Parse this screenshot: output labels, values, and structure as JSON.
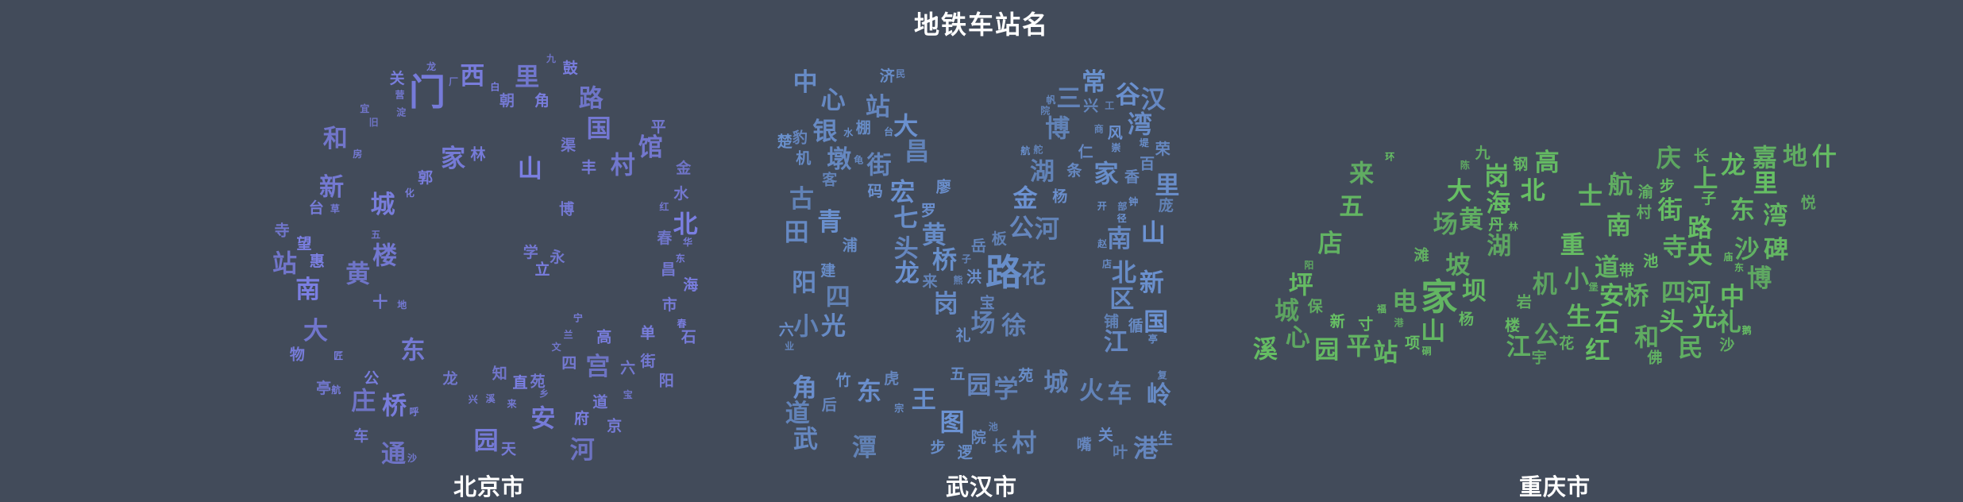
{
  "title": "地铁车站名",
  "chart_data": [
    {
      "type": "wordcloud",
      "city": "北京市",
      "color": "#7b7fe3",
      "words": [
        [
          "门",
          4
        ],
        [
          "路",
          3
        ],
        [
          "村",
          3
        ],
        [
          "宫",
          3
        ],
        [
          "里",
          3
        ],
        [
          "庄",
          3
        ],
        [
          "桥",
          3
        ],
        [
          "家",
          3
        ],
        [
          "西",
          3
        ],
        [
          "山",
          3
        ],
        [
          "站",
          3
        ],
        [
          "东",
          3
        ],
        [
          "黄",
          3
        ],
        [
          "河",
          3
        ],
        [
          "城",
          3
        ],
        [
          "园",
          3
        ],
        [
          "大",
          3
        ],
        [
          "安",
          3
        ],
        [
          "国",
          3
        ],
        [
          "南",
          3
        ],
        [
          "北",
          3
        ],
        [
          "新",
          3
        ],
        [
          "楼",
          3
        ],
        [
          "馆",
          3
        ],
        [
          "通",
          3
        ],
        [
          "和",
          3
        ],
        [
          "京",
          2
        ],
        [
          "惠",
          2
        ],
        [
          "府",
          2
        ],
        [
          "博",
          2
        ],
        [
          "立",
          2
        ],
        [
          "望",
          2
        ],
        [
          "海",
          2
        ],
        [
          "街",
          2
        ],
        [
          "鼓",
          2
        ],
        [
          "台",
          2
        ],
        [
          "郭",
          2
        ],
        [
          "高",
          2
        ],
        [
          "单",
          2
        ],
        [
          "渠",
          2
        ],
        [
          "关",
          2
        ],
        [
          "车",
          2
        ],
        [
          "丰",
          2
        ],
        [
          "苑",
          2
        ],
        [
          "天",
          2
        ],
        [
          "六",
          2
        ],
        [
          "学",
          2
        ],
        [
          "十",
          2
        ],
        [
          "平",
          2
        ],
        [
          "永",
          2
        ],
        [
          "朝",
          2
        ],
        [
          "四",
          2
        ],
        [
          "阳",
          2
        ],
        [
          "寺",
          2
        ],
        [
          "市",
          2
        ],
        [
          "金",
          2
        ],
        [
          "春",
          2
        ],
        [
          "林",
          2
        ],
        [
          "直",
          2
        ],
        [
          "公",
          2
        ],
        [
          "知",
          2
        ],
        [
          "龙",
          2
        ],
        [
          "角",
          2
        ],
        [
          "石",
          2
        ],
        [
          "亭",
          2
        ],
        [
          "昌",
          2
        ],
        [
          "道",
          2
        ],
        [
          "水",
          2
        ],
        [
          "物",
          2
        ],
        [
          "乡",
          1
        ],
        [
          "化",
          1
        ],
        [
          "九",
          1
        ],
        [
          "溪",
          1
        ],
        [
          "华",
          1
        ],
        [
          "红",
          1
        ],
        [
          "房",
          1
        ],
        [
          "宝",
          1
        ],
        [
          "兴",
          1
        ],
        [
          "五",
          1
        ],
        [
          "白",
          1
        ],
        [
          "匠",
          1
        ],
        [
          "营",
          1
        ],
        [
          "来",
          1
        ],
        [
          "宁",
          1
        ],
        [
          "宜",
          1
        ],
        [
          "龙",
          1
        ],
        [
          "兰",
          1
        ],
        [
          "草",
          1
        ],
        [
          "沙",
          1
        ],
        [
          "文",
          1
        ],
        [
          "地",
          1
        ],
        [
          "旧",
          1
        ],
        [
          "淀",
          1
        ],
        [
          "航",
          1
        ],
        [
          "呼",
          1
        ],
        [
          "春",
          1
        ],
        [
          "厂",
          1
        ],
        [
          "东",
          1
        ]
      ]
    },
    {
      "type": "wordcloud",
      "city": "武汉市",
      "color": "#6c93d3",
      "words": [
        [
          "路",
          4
        ],
        [
          "家",
          3
        ],
        [
          "街",
          3
        ],
        [
          "湖",
          3
        ],
        [
          "桥",
          3
        ],
        [
          "站",
          3
        ],
        [
          "区",
          3
        ],
        [
          "大",
          3
        ],
        [
          "阳",
          3
        ],
        [
          "村",
          3
        ],
        [
          "光",
          3
        ],
        [
          "汉",
          3
        ],
        [
          "古",
          3
        ],
        [
          "博",
          3
        ],
        [
          "山",
          3
        ],
        [
          "中",
          3
        ],
        [
          "岗",
          3
        ],
        [
          "国",
          3
        ],
        [
          "武",
          3
        ],
        [
          "宏",
          3
        ],
        [
          "银",
          3
        ],
        [
          "新",
          3
        ],
        [
          "场",
          3
        ],
        [
          "湾",
          3
        ],
        [
          "墩",
          3
        ],
        [
          "南",
          3
        ],
        [
          "角",
          3
        ],
        [
          "岭",
          3
        ],
        [
          "田",
          3
        ],
        [
          "头",
          3
        ],
        [
          "小",
          3
        ],
        [
          "王",
          3
        ],
        [
          "心",
          3
        ],
        [
          "青",
          3
        ],
        [
          "三",
          3
        ],
        [
          "河",
          3
        ],
        [
          "港",
          3
        ],
        [
          "城",
          3
        ],
        [
          "火",
          3
        ],
        [
          "常",
          3
        ],
        [
          "徐",
          3
        ],
        [
          "东",
          3
        ],
        [
          "花",
          3
        ],
        [
          "谷",
          3
        ],
        [
          "公",
          3
        ],
        [
          "龙",
          3
        ],
        [
          "江",
          3
        ],
        [
          "道",
          3
        ],
        [
          "里",
          3
        ],
        [
          "昌",
          3
        ],
        [
          "学",
          3
        ],
        [
          "园",
          3
        ],
        [
          "图",
          3
        ],
        [
          "四",
          3
        ],
        [
          "七",
          3
        ],
        [
          "黄",
          3
        ],
        [
          "北",
          3
        ],
        [
          "潭",
          3
        ],
        [
          "金",
          3
        ],
        [
          "车",
          3
        ],
        [
          "香",
          2
        ],
        [
          "关",
          2
        ],
        [
          "苑",
          2
        ],
        [
          "济",
          2
        ],
        [
          "风",
          2
        ],
        [
          "铺",
          2
        ],
        [
          "浦",
          2
        ],
        [
          "百",
          2
        ],
        [
          "竹",
          2
        ],
        [
          "杨",
          2
        ],
        [
          "兴",
          2
        ],
        [
          "楚",
          2
        ],
        [
          "院",
          2
        ],
        [
          "板",
          2
        ],
        [
          "荣",
          2
        ],
        [
          "嘴",
          2
        ],
        [
          "循",
          2
        ],
        [
          "礼",
          2
        ],
        [
          "豹",
          2
        ],
        [
          "客",
          2
        ],
        [
          "罗",
          2
        ],
        [
          "棚",
          2
        ],
        [
          "庞",
          2
        ],
        [
          "建",
          2
        ],
        [
          "宝",
          2
        ],
        [
          "条",
          2
        ],
        [
          "后",
          2
        ],
        [
          "五",
          2
        ],
        [
          "码",
          2
        ],
        [
          "机",
          2
        ],
        [
          "生",
          2
        ],
        [
          "洪",
          2
        ],
        [
          "来",
          2
        ],
        [
          "六",
          2
        ],
        [
          "廖",
          2
        ],
        [
          "逻",
          2
        ],
        [
          "长",
          2
        ],
        [
          "步",
          2
        ],
        [
          "虎",
          2
        ],
        [
          "岳",
          2
        ],
        [
          "仁",
          2
        ],
        [
          "叶",
          2
        ],
        [
          "工",
          1
        ],
        [
          "子",
          1
        ],
        [
          "台",
          1
        ],
        [
          "部",
          1
        ],
        [
          "复",
          1
        ],
        [
          "钟",
          1
        ],
        [
          "民",
          1
        ],
        [
          "宗",
          1
        ],
        [
          "业",
          1
        ],
        [
          "帆",
          1
        ],
        [
          "院",
          1
        ],
        [
          "赵",
          1
        ],
        [
          "水",
          1
        ],
        [
          "池",
          1
        ],
        [
          "开",
          1
        ],
        [
          "亭",
          1
        ],
        [
          "龟",
          1
        ],
        [
          "熊",
          1
        ],
        [
          "航",
          1
        ],
        [
          "崇",
          1
        ],
        [
          "径",
          1
        ],
        [
          "商",
          1
        ],
        [
          "堤",
          1
        ],
        [
          "店",
          1
        ],
        [
          "舵",
          1
        ]
      ]
    },
    {
      "type": "wordcloud",
      "city": "重庆市",
      "color": "#67c264",
      "words": [
        [
          "家",
          4
        ],
        [
          "路",
          3
        ],
        [
          "湖",
          3
        ],
        [
          "大",
          3
        ],
        [
          "城",
          3
        ],
        [
          "中",
          3
        ],
        [
          "岗",
          3
        ],
        [
          "湾",
          3
        ],
        [
          "场",
          3
        ],
        [
          "航",
          3
        ],
        [
          "民",
          3
        ],
        [
          "里",
          3
        ],
        [
          "山",
          3
        ],
        [
          "道",
          3
        ],
        [
          "地",
          3
        ],
        [
          "红",
          3
        ],
        [
          "北",
          3
        ],
        [
          "庆",
          3
        ],
        [
          "溪",
          3
        ],
        [
          "重",
          3
        ],
        [
          "坪",
          3
        ],
        [
          "园",
          3
        ],
        [
          "站",
          3
        ],
        [
          "坝",
          3
        ],
        [
          "四",
          3
        ],
        [
          "桥",
          3
        ],
        [
          "东",
          3
        ],
        [
          "沙",
          3
        ],
        [
          "上",
          3
        ],
        [
          "心",
          3
        ],
        [
          "嘉",
          3
        ],
        [
          "石",
          3
        ],
        [
          "小",
          3
        ],
        [
          "头",
          3
        ],
        [
          "江",
          3
        ],
        [
          "坡",
          3
        ],
        [
          "和",
          3
        ],
        [
          "机",
          3
        ],
        [
          "海",
          3
        ],
        [
          "礼",
          3
        ],
        [
          "南",
          3
        ],
        [
          "平",
          3
        ],
        [
          "寺",
          3
        ],
        [
          "什",
          3
        ],
        [
          "街",
          3
        ],
        [
          "光",
          3
        ],
        [
          "博",
          3
        ],
        [
          "碑",
          3
        ],
        [
          "央",
          3
        ],
        [
          "公",
          3
        ],
        [
          "店",
          3
        ],
        [
          "龙",
          3
        ],
        [
          "安",
          3
        ],
        [
          "生",
          3
        ],
        [
          "来",
          3
        ],
        [
          "河",
          3
        ],
        [
          "士",
          3
        ],
        [
          "黄",
          3
        ],
        [
          "电",
          3
        ],
        [
          "高",
          3
        ],
        [
          "五",
          3
        ],
        [
          "长",
          2
        ],
        [
          "宇",
          2
        ],
        [
          "渝",
          2
        ],
        [
          "项",
          2
        ],
        [
          "花",
          2
        ],
        [
          "新",
          2
        ],
        [
          "岩",
          2
        ],
        [
          "九",
          2
        ],
        [
          "沙",
          2
        ],
        [
          "杨",
          2
        ],
        [
          "悦",
          2
        ],
        [
          "池",
          2
        ],
        [
          "保",
          2
        ],
        [
          "楼",
          2
        ],
        [
          "步",
          2
        ],
        [
          "带",
          2
        ],
        [
          "村",
          2
        ],
        [
          "丹",
          2
        ],
        [
          "寸",
          2
        ],
        [
          "子",
          2
        ],
        [
          "滩",
          2
        ],
        [
          "佛",
          2
        ],
        [
          "钢",
          2
        ],
        [
          "东",
          1
        ],
        [
          "鹅",
          1
        ],
        [
          "福",
          1
        ],
        [
          "林",
          1
        ],
        [
          "陈",
          1
        ],
        [
          "环",
          1
        ],
        [
          "港",
          1
        ],
        [
          "庙",
          1
        ],
        [
          "硐",
          1
        ],
        [
          "堡",
          1
        ],
        [
          "阳",
          1
        ]
      ]
    }
  ]
}
